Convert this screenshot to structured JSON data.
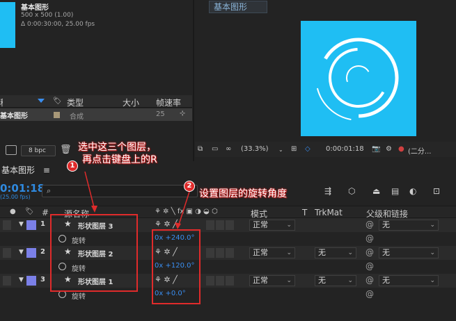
{
  "project": {
    "comp_name": "基本图形",
    "comp_dims": "500 x 500 (1.00)",
    "comp_duration": "Δ 0:00:30:00, 25.00 fps",
    "columns": {
      "type": "类型",
      "size": "大小",
      "frame_rate": "帧速率"
    },
    "row": {
      "name": "基本图形",
      "type": "合成",
      "rate": "25"
    },
    "bpc": "8 bpc"
  },
  "viewer": {
    "tab_label": "基本图形",
    "zoom": "(33.3%)",
    "timecode": "0:00:01:18",
    "resolution": "(二分..."
  },
  "timeline": {
    "tab_label": "基本图形",
    "timecode": "0:01:18",
    "fps": "(25.00 fps)",
    "columns": {
      "num": "#",
      "source_name": "源名称",
      "mode": "模式",
      "t": "T",
      "trkmat": "TrkMat",
      "parent": "父级和链接"
    },
    "layers": [
      {
        "index": "1",
        "name": "形状图层 3",
        "mode": "正常",
        "trkmat": "",
        "parent": "无",
        "prop_name": "旋转",
        "prop_value": "0x +240.0°"
      },
      {
        "index": "2",
        "name": "形状图层 2",
        "mode": "正常",
        "trkmat": "无",
        "parent": "无",
        "prop_name": "旋转",
        "prop_value": "0x +120.0°"
      },
      {
        "index": "3",
        "name": "形状图层 1",
        "mode": "正常",
        "trkmat": "无",
        "parent": "无",
        "prop_name": "旋转",
        "prop_value": "0x +0.0°"
      }
    ]
  },
  "annotations": {
    "badge1": "1",
    "badge2": "2",
    "note1_line1": "选中这三个图层，",
    "note1_line2": "再点击键盘上的R",
    "note2": "设置图层的旋转角度"
  },
  "colors": {
    "accent": "#2f8ae0",
    "canvas": "#1fbef3",
    "layer_label": "#7b80e8",
    "annotation": "#e02b2b"
  }
}
